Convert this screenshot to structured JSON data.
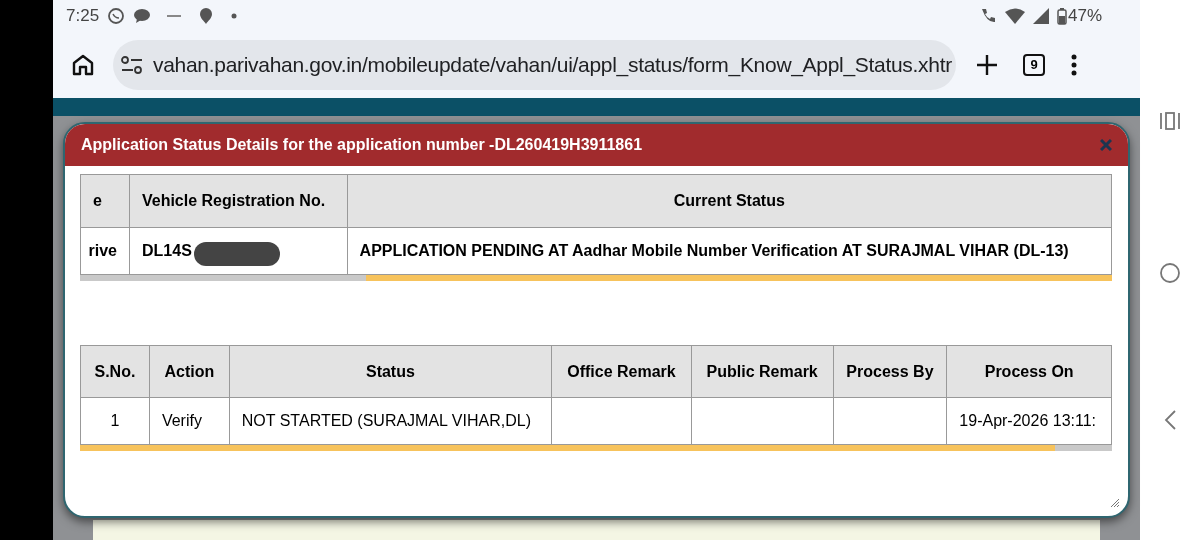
{
  "status_bar": {
    "time": "7:25",
    "battery": "47%"
  },
  "browser": {
    "url": "vahan.parivahan.gov.in/mobileupdate/vahan/ui/appl_status/form_Know_Appl_Status.xhtr",
    "tab_count": "9"
  },
  "dialog": {
    "title": "Application Status Details for the application number -DL260419H3911861",
    "summary_table": {
      "columns": [
        "e",
        "Vehicle Registration No.",
        "Current Status"
      ],
      "rows": [
        [
          "rive",
          "DL14S",
          "APPLICATION PENDING AT Aadhar Mobile Number Verification AT SURAJMAL VIHAR (DL-13)"
        ]
      ]
    },
    "history_table": {
      "columns": [
        "S.No.",
        "Action",
        "Status",
        "Office Remark",
        "Public Remark",
        "Process By",
        "Process On"
      ],
      "rows": [
        [
          "1",
          "Verify",
          "NOT STARTED (SURAJMAL VIHAR,DL)",
          null,
          null,
          null,
          "19-Apr-2026 13:11:"
        ]
      ]
    }
  }
}
